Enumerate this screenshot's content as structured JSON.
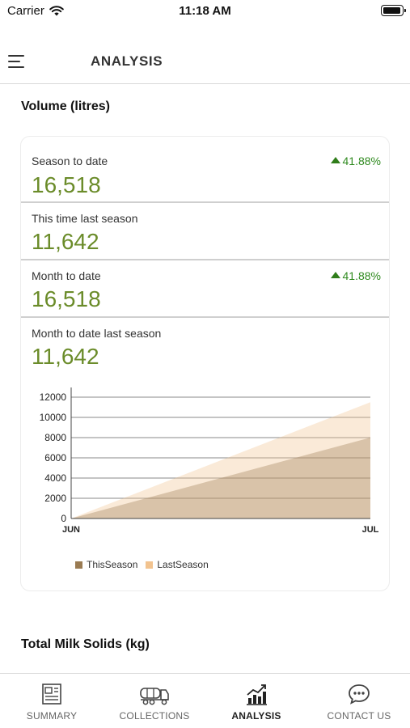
{
  "status_bar": {
    "carrier": "Carrier",
    "time": "11:18 AM"
  },
  "header": {
    "title": "ANALYSIS",
    "menu_icon": "hamburger-menu-icon"
  },
  "volume": {
    "title": "Volume (litres)",
    "stats": [
      {
        "label": "Season to date",
        "value": "16,518",
        "change": "41.88%",
        "trend": "up"
      },
      {
        "label": "This time last season",
        "value": "11,642"
      },
      {
        "label": "Month to date",
        "value": "16,518",
        "change": "41.88%",
        "trend": "up"
      },
      {
        "label": "Month to date last season",
        "value": "11,642"
      }
    ]
  },
  "chart_data": {
    "type": "area",
    "x": [
      "JUN",
      "JUL"
    ],
    "x_tick_labels": [
      "JUN",
      "JUL"
    ],
    "y_tick_labels": [
      "12000",
      "10000",
      "8000",
      "6000",
      "4000",
      "2000",
      "0"
    ],
    "ylim": [
      0,
      12000
    ],
    "grid": true,
    "legend_placement": "bottom-left",
    "series": [
      {
        "name": "ThisSeason",
        "values": [
          0,
          8000
        ],
        "color": "#9a7b52"
      },
      {
        "name": "LastSeason",
        "values": [
          0,
          11500
        ],
        "color": "#f2c38f"
      }
    ]
  },
  "milk_solids": {
    "title": "Total Milk Solids (kg)"
  },
  "tabbar": {
    "tabs": [
      {
        "label": "SUMMARY",
        "icon": "summary-newspaper-icon",
        "active": false
      },
      {
        "label": "COLLECTIONS",
        "icon": "tanker-truck-icon",
        "active": false
      },
      {
        "label": "ANALYSIS",
        "icon": "bar-chart-trend-icon",
        "active": true
      },
      {
        "label": "CONTACT US",
        "icon": "chat-bubble-icon",
        "active": false
      }
    ]
  }
}
